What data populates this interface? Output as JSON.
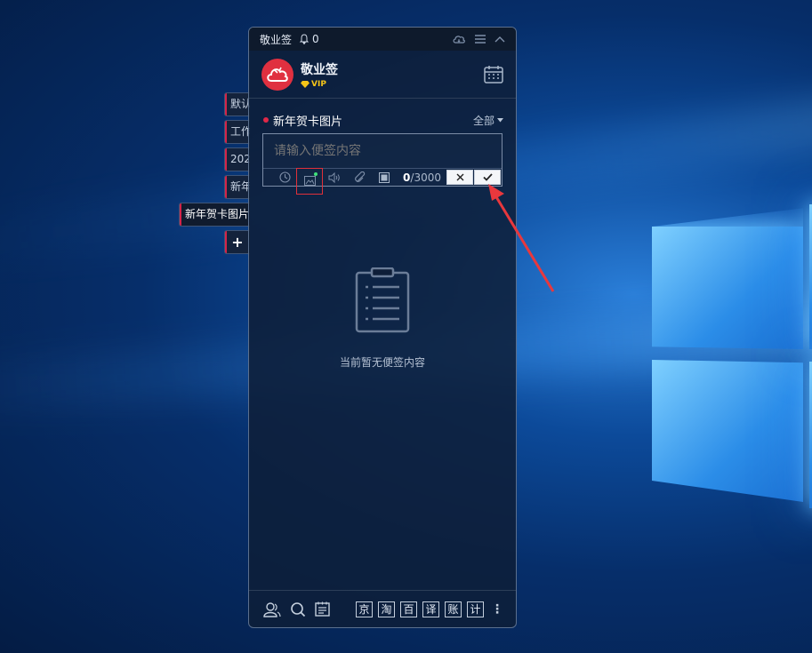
{
  "window": {
    "app_name": "敬业签",
    "notification_count": "0"
  },
  "user": {
    "name": "敬业签",
    "badge": "VIP"
  },
  "categories": [
    {
      "label": "默认"
    },
    {
      "label": "工作"
    },
    {
      "label": "202"
    },
    {
      "label": "新年"
    },
    {
      "label": "新年贺卡图片"
    },
    {
      "label": "+"
    }
  ],
  "current_category": {
    "title": "新年贺卡图片",
    "filter": "全部"
  },
  "editor": {
    "placeholder": "请输入便签内容",
    "char_count": "0",
    "char_limit": "/3000"
  },
  "empty_state": {
    "message": "当前暂无便签内容"
  },
  "bottom_tools": [
    "京",
    "淘",
    "百",
    "译",
    "账",
    "计"
  ],
  "colors": {
    "accent_red": "#e02848",
    "vip_gold": "#f5c518",
    "annotation_red": "#e0303a"
  }
}
